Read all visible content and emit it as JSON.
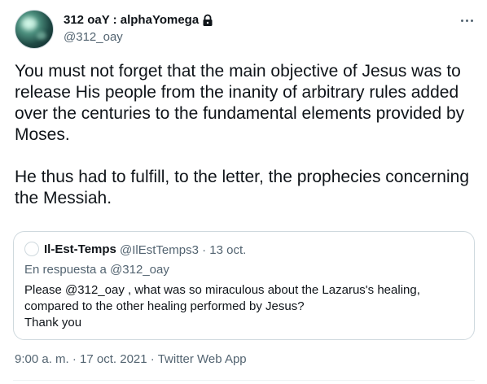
{
  "author": {
    "display_name": "312 oaY : alphaYomega",
    "handle": "@312_oay",
    "protected_icon": "lock-icon"
  },
  "tweet": {
    "paragraphs": [
      "You must not forget that the main objective of Jesus was to release His people from the inanity of arbitrary rules added over the centuries to the fundamental elements provided by Moses.",
      "He thus had to fulfill, to the letter, the prophecies concerning the Messiah."
    ]
  },
  "quoted_tweet": {
    "display_name": "Il-Est-Temps",
    "handle": "@IlEstTemps3",
    "separator": "·",
    "date": "13 oct.",
    "reply_to_label": "En respuesta a @312_oay",
    "text_lines": [
      "Please @312_oay , what was so miraculous about the Lazarus's healing,",
      "compared to the other healing performed by Jesus?",
      "Thank you"
    ]
  },
  "footer": {
    "time": "9:00 a. m.",
    "separator": "·",
    "date": "17 oct. 2021",
    "source": "Twitter Web App"
  },
  "icons": {
    "more": "more-horizontal-icon",
    "lock": "lock-icon"
  },
  "colors": {
    "text_primary": "#0f1419",
    "text_secondary": "#536471",
    "border": "#cfd9de"
  }
}
